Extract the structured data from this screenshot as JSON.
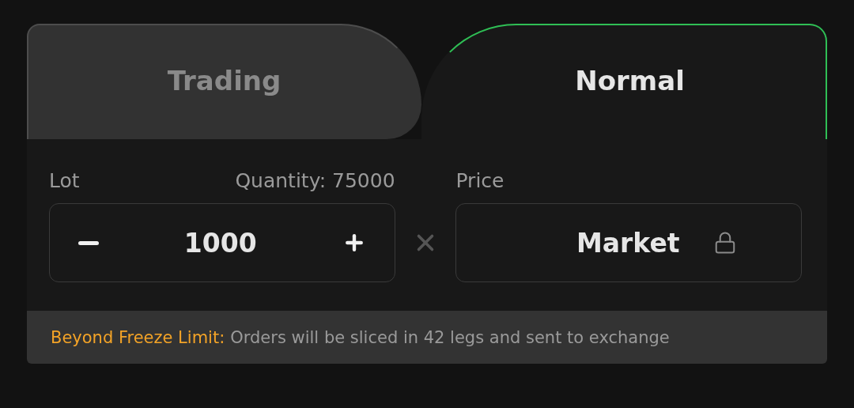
{
  "tabs": [
    {
      "label": "Trading",
      "selected": false
    },
    {
      "label": "Normal",
      "selected": true
    }
  ],
  "lot": {
    "label": "Lot",
    "quantity": "Quantity: 75000",
    "value": "1000"
  },
  "price": {
    "label": "Price",
    "value": "Market",
    "locked": true
  },
  "notice": {
    "label": "Beyond Freeze Limit:",
    "message": "Orders will be sliced in 42 legs and sent to exchange"
  }
}
